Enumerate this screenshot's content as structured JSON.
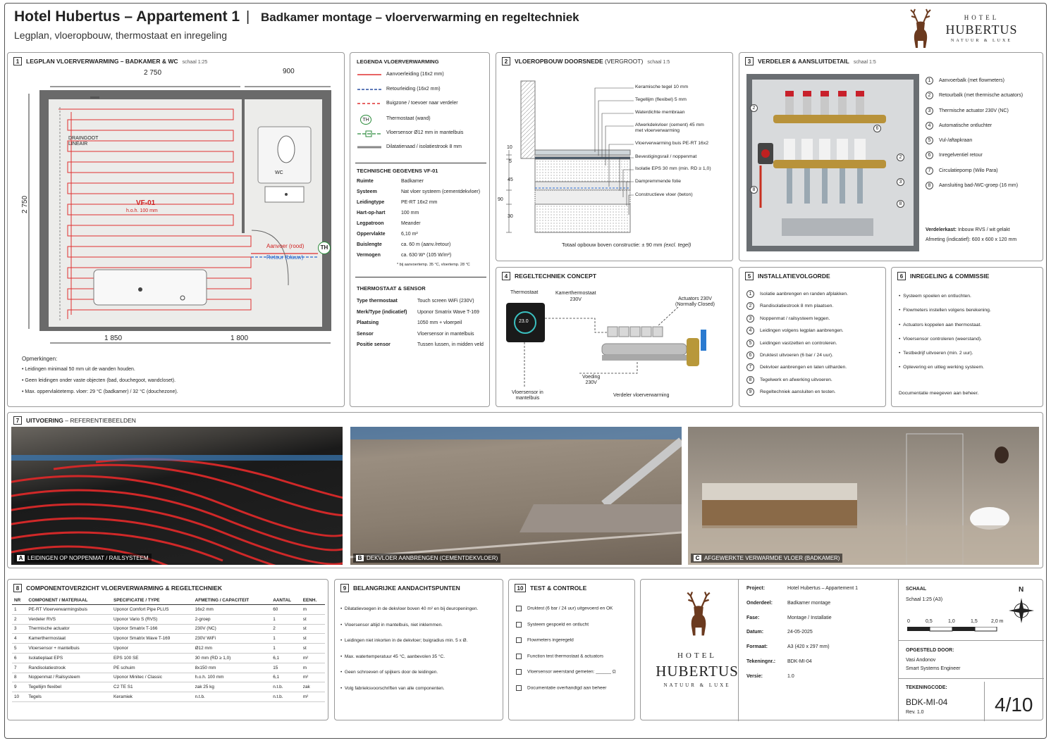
{
  "header": {
    "title": "Hotel Hubertus – Appartement 1",
    "sep": "|",
    "subtitle": "Badkamer montage – vloerverwarming en regeltechniek",
    "desc": "Legplan, vloeropbouw, thermostaat en inregeling"
  },
  "logo": {
    "top": "HOTEL",
    "name": "HUBERTUS",
    "tag": "NATUUR & LUXE"
  },
  "p1": {
    "num": "1",
    "title": "LEGPLAN VLOERVERWARMING – BADKAMER & WC",
    "scale": "schaal 1:25",
    "dim_top1": "2 750",
    "dim_top2": "900",
    "dim_left": "2 750",
    "dim_bot1": "1 850",
    "dim_bot2": "1 800",
    "drain": "DRAINGOOT\nLINEAIR",
    "wc": "WC",
    "vf": "VF-01",
    "hoh": "h.o.h. 100 mm",
    "aanvoer": "Aanvoer (rood)",
    "retour": "Retour (blauw)",
    "th": "TH",
    "notes_title": "Opmerkingen:",
    "notes": [
      "Leidingen minimaal 50 mm uit de wanden houden.",
      "Geen leidingen onder vaste objecten (bad, douchegoot, wandcloset).",
      "Max. oppervlaktetemp. vloer: 29 °C (badkamer) / 32 °C (douchezone)."
    ]
  },
  "legend": {
    "title": "LEGENDA VLOERVERWARMING",
    "items": [
      "Aanvoerleiding (16x2 mm)",
      "Retourleiding (16x2 mm)",
      "Buigzone / toevoer naar verdeler",
      "Thermostaat (wand)",
      "Vloersensor Ø12 mm in mantelbuis",
      "Dilatatienaad / isolatiestrook 8 mm"
    ],
    "th": "TH",
    "tech_title": "TECHNISCHE GEGEVENS VF-01",
    "tech": [
      [
        "Ruimte",
        "Badkamer"
      ],
      [
        "Systeem",
        "Nat vloer systeem (cementdekvloer)"
      ],
      [
        "Leidingtype",
        "PE-RT 16x2 mm"
      ],
      [
        "Hart-op-hart",
        "100 mm"
      ],
      [
        "Legpatroon",
        "Meander"
      ],
      [
        "Oppervlakte",
        "6,10 m²"
      ],
      [
        "Buislengte",
        "ca. 60 m (aanv./retour)"
      ],
      [
        "Vermogen",
        "ca. 630 W* (105 W/m²)"
      ]
    ],
    "tech_note": "* bij aanvoertemp. 35 °C, vloertemp. 28 °C",
    "thermo_title": "THERMOSTAAT & SENSOR",
    "thermo": [
      [
        "Type thermostaat",
        "Touch screen WiFi (230V)"
      ],
      [
        "Merk/Type (indicatief)",
        "Uponor Smatrix Wave T-169"
      ],
      [
        "Plaatsing",
        "1050 mm + vloerpeil"
      ],
      [
        "Sensor",
        "Vloersensor in mantelbuis"
      ],
      [
        "Positie sensor",
        "Tussen lussen, in midden veld"
      ]
    ]
  },
  "p2": {
    "num": "2",
    "title": "VLOEROPBOUW DOORSNEDE",
    "title2": "(VERGROOT)",
    "scale": "schaal 1:5",
    "labels": [
      "Keramische tegel 10 mm",
      "Tegellijm (flexibel) 5 mm",
      "Waterdichte membraan",
      "Afwerkdekvloer (cement) 45 mm\nmet vloerverwarming",
      "Vloerverwarming buis PE-RT 16x2",
      "Bevestigingsrail / noppenmat",
      "Isolatie EPS 30 mm (min. RD ≥ 1,0)",
      "Dampremmende folie",
      "Constructieve vloer (beton)"
    ],
    "dims": [
      "10",
      "5",
      "45",
      "90",
      "30"
    ],
    "total": "Totaal opbouw boven constructie: ± 90 mm",
    "total2": "(excl. tegel)"
  },
  "p3": {
    "num": "3",
    "title": "VERDELER & AANSLUITDETAIL",
    "scale": "schaal 1:5",
    "items": [
      "Aanvoerbalk (met flowmeters)",
      "Retourbalk (met thermische actuators)",
      "Thermische actuator 230V (NC)",
      "Automatische ontluchter",
      "Vul-/aftapkraan",
      "Inregelventiel retour",
      "Circulatiepomp (Wilo Para)",
      "Aansluiting bad-/WC-groep (16 mm)"
    ],
    "kast1": "Verdelerkast:",
    "kast1v": "Inbouw RVS / wit gelakt",
    "kast2": "Afmeting (indicatief): 600 x 600 x 120 mm",
    "callouts": [
      "2",
      "6",
      "2",
      "3",
      "8",
      "8"
    ]
  },
  "p4": {
    "num": "4",
    "title": "REGELTECHNIEK CONCEPT",
    "thermostaat": "Thermostaat",
    "kamer": "Kamerthermostaat\n230V",
    "act": "Actuators 230V\n(Normally Closed)",
    "voeding": "Voeding\n230V",
    "sensor": "Vloersensor in\nmantelbuis",
    "verdeler": "Verdeler vloerverwarming",
    "display": "23.0"
  },
  "p5": {
    "num": "5",
    "title": "INSTALLATIEVOLGORDE",
    "items": [
      "Isolatie aanbrengen en randen afplakken.",
      "Randisolatiestrook 8 mm plaatsen.",
      "Noppenmat / railsysteem leggen.",
      "Leidingen volgens legplan aanbrengen.",
      "Leidingen vastzetten en controleren.",
      "Druktest uitvoeren (6 bar / 24 uur).",
      "Dekvloer aanbrengen en laten uitharden.",
      "Tegelwerk en afwerking uitvoeren.",
      "Regeltechniek aansluiten en testen."
    ]
  },
  "p6": {
    "num": "6",
    "title": "INREGELING & COMMISSIE",
    "items": [
      "Systeem spoelen en ontluchten.",
      "Flowmeters instellen volgens berekening.",
      "Actuators koppelen aan thermostaat.",
      "Vloersensor controleren (weerstand).",
      "Testbedrijf uitvoeren (min. 2 uur).",
      "Oplevering en uitleg werking systeem."
    ],
    "doc": "Documentatie meegeven aan beheer."
  },
  "p7": {
    "num": "7",
    "title": "UITVOERING",
    "title2": "– REFERENTIEBEELDEN",
    "caps": [
      [
        "A",
        "LEIDINGEN OP NOPPENMAT / RAILSYSTEEM"
      ],
      [
        "B",
        "DEKVLOER AANBRENGEN (CEMENTDEKVLOER)"
      ],
      [
        "C",
        "AFGEWERKTE VERWARMDE VLOER (BADKAMER)"
      ]
    ]
  },
  "p8": {
    "num": "8",
    "title": "COMPONENTOVERZICHT VLOERVERWARMING & REGELTECHNIEK",
    "headers": [
      "NR",
      "COMPONENT / MATERIAAL",
      "SPECIFICATIE / TYPE",
      "AFMETING / CAPACITEIT",
      "AANTAL",
      "EENH."
    ],
    "rows": [
      [
        "1",
        "PE-RT Vloerverwarmingsbuis",
        "Uponor Comfort Pipe PLUS",
        "16x2 mm",
        "60",
        "m"
      ],
      [
        "2",
        "Verdeler RVS",
        "Uponor Vario S (RVS)",
        "2-groep",
        "1",
        "st"
      ],
      [
        "3",
        "Thermische actuator",
        "Uponor Smatrix T-166",
        "230V (NC)",
        "2",
        "st"
      ],
      [
        "4",
        "Kamerthermostaat",
        "Uponor Smatrix Wave T-169",
        "230V WiFi",
        "1",
        "st"
      ],
      [
        "5",
        "Vloersensor + mantelbuis",
        "Uponor",
        "Ø12 mm",
        "1",
        "st"
      ],
      [
        "6",
        "Isolatieplaat EPS",
        "EPS 100 SE",
        "30 mm (RD ≥ 1,0)",
        "6,1",
        "m²"
      ],
      [
        "7",
        "Randisolatiestrook",
        "PE schuim",
        "8x150 mm",
        "15",
        "m"
      ],
      [
        "8",
        "Noppenmat / Railsysteem",
        "Uponor Minitec / Classic",
        "h.o.h. 100 mm",
        "6,1",
        "m²"
      ],
      [
        "9",
        "Tegellijm flexibel",
        "C2 TE S1",
        "zak 25 kg",
        "n.t.b.",
        "zak"
      ],
      [
        "10",
        "Tegels",
        "Keramiek",
        "n.t.b.",
        "n.t.b.",
        "m²"
      ]
    ]
  },
  "p9": {
    "num": "9",
    "title": "BELANGRIJKE AANDACHTSPUNTEN",
    "items": [
      "Dilatatievoegen in de dekvloer boven 40 m² en bij deuropeningen.",
      "Vloersensor altijd in mantelbuis, niet inklemmen.",
      "Leidingen niet inkorten in de dekvloer; buigradius min. 5 x Ø.",
      "Max. watertemperatuur 45 °C, aanbevolen 35 °C.",
      "Geen schroeven of spijkers door de leidingen.",
      "Volg fabrieksvoorschriften van alle componenten."
    ]
  },
  "p10": {
    "num": "10",
    "title": "TEST & CONTROLE",
    "items": [
      "Druktest (6 bar / 24 uur) uitgevoerd en OK",
      "Systeem gespoeld en ontlucht",
      "Flowmeters ingeregeld",
      "Function test thermostaat & actuators",
      "Vloersensor weerstand gemeten: ______ Ω",
      "Documentatie overhandigd aan beheer"
    ]
  },
  "tb": {
    "rows": [
      [
        "Project:",
        "Hotel Hubertus – Appartement 1"
      ],
      [
        "Onderdeel:",
        "Badkamer montage"
      ],
      [
        "Fase:",
        "Montage / Installatie"
      ],
      [
        "Datum:",
        "24-05-2025"
      ],
      [
        "Formaat:",
        "A3 (420 x 297 mm)"
      ],
      [
        "Tekeningnr.:",
        "BDK-MI-04"
      ],
      [
        "Versie:",
        "1.0"
      ]
    ],
    "schaal": "SCHAAL",
    "schaal_v": "Schaal 1:25 (A3)",
    "north": "N",
    "ticks": [
      "0",
      "0,5",
      "1,0",
      "1,5",
      "2,0 m"
    ],
    "opg": "OPGESTELD DOOR:",
    "name": "Vasi Andonov",
    "role": "Smart Systems Engineer",
    "code_l": "TEKENINGCODE:",
    "code": "BDK-MI-04",
    "rev": "Rev.  1.0",
    "page": "4/10"
  }
}
